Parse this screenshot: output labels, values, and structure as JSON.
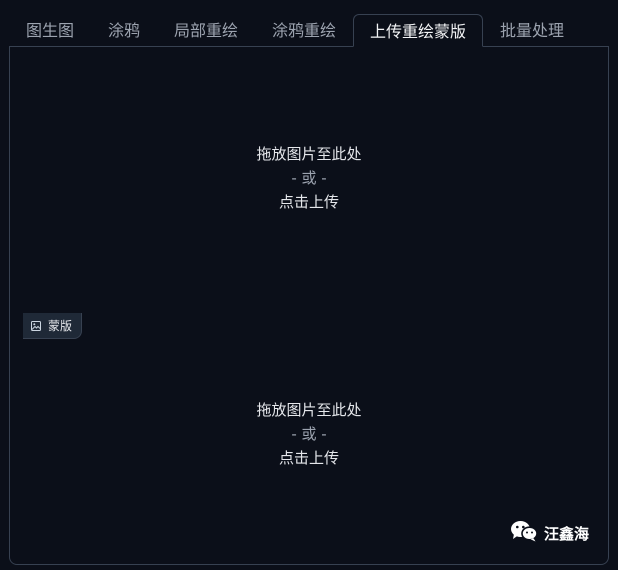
{
  "tabs": [
    {
      "label": "图生图"
    },
    {
      "label": "涂鸦"
    },
    {
      "label": "局部重绘"
    },
    {
      "label": "涂鸦重绘"
    },
    {
      "label": "上传重绘蒙版"
    },
    {
      "label": "批量处理"
    }
  ],
  "active_tab": "上传重绘蒙版",
  "image_upload": {
    "drop_text": "拖放图片至此处",
    "or_text": "- 或 -",
    "click_text": "点击上传"
  },
  "mask_upload": {
    "label": "蒙版",
    "icon": "image-icon",
    "drop_text": "拖放图片至此处",
    "or_text": "- 或 -",
    "click_text": "点击上传"
  },
  "watermark": {
    "icon": "wechat-icon",
    "text": "汪鑫海"
  },
  "colors": {
    "background": "#0b0f19",
    "border": "#374151",
    "text": "#e5e7eb",
    "muted_text": "#9ca3af",
    "label_bg": "#1f2937"
  }
}
